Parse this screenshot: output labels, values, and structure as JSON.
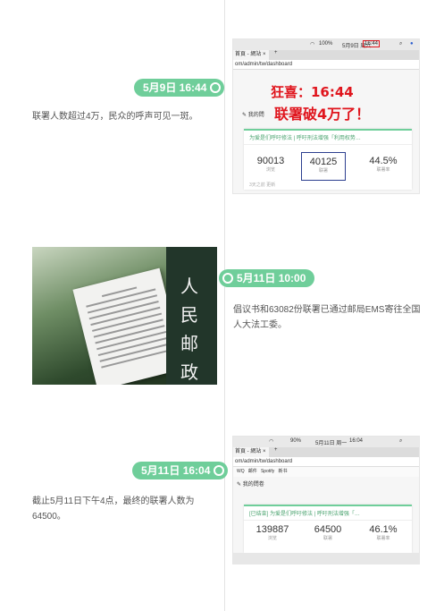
{
  "entries": [
    {
      "date": "5月9日 16:44",
      "text": "联署人数超过4万，民众的呼声可见一斑。",
      "screenshot": {
        "menubar": {
          "battery": "100%",
          "date": "5月9日 周六",
          "time": "16:44"
        },
        "tab_title": "首頁 - 網站",
        "url": "om/admin/tw/dashboard",
        "stamp_line1": "狂喜：16:44",
        "stamp_line2": "联署破4万了！",
        "page_title": "我的問",
        "card_title": "为爱是们呼吁修法 | 呼吁刑法增强「利用权势…",
        "stats": [
          {
            "value": "90013",
            "label": "浏览"
          },
          {
            "value": "40125",
            "label": "联署"
          },
          {
            "value": "44.5%",
            "label": "联署率"
          }
        ],
        "footer": "3天之前 更新"
      }
    },
    {
      "date": "5月11日 10:00",
      "text": "倡议书和63082份联署已通过邮局EMS寄往全国人大法工委。",
      "photo": {
        "board_chars": [
          "人",
          "民",
          "邮",
          "政"
        ]
      }
    },
    {
      "date": "5月11日 16:04",
      "text": "截止5月11日下午4点，最终的联署人数为64500。",
      "screenshot": {
        "menubar": {
          "battery": "90%",
          "date": "5月11日 周一",
          "time": "16:04"
        },
        "tab_title": "首頁 - 網站",
        "url": "om/admin/tw/dashboard",
        "bookmarks": [
          "WQ",
          "邮件",
          "Spotify",
          "新书"
        ],
        "page_title": "我的問卷",
        "card_title": "[已结束] 为爱是们呼吁修法 | 呼吁刑法增强「…",
        "stats": [
          {
            "value": "139887",
            "label": "浏览"
          },
          {
            "value": "64500",
            "label": "联署"
          },
          {
            "value": "46.1%",
            "label": "联署率"
          }
        ]
      }
    }
  ],
  "colors": {
    "accent": "#6fce9a",
    "stamp": "#e0151d",
    "highlight": "#2c3f8f"
  }
}
